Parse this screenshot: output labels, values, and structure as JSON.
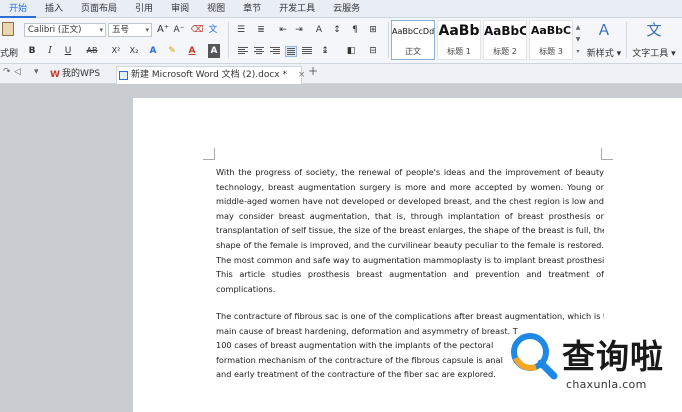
{
  "menu": {
    "tabs": [
      "开始",
      "插入",
      "页面布局",
      "引用",
      "审阅",
      "视图",
      "章节",
      "开发工具",
      "云服务"
    ],
    "active": "开始"
  },
  "ribbon": {
    "paste_label": "式刷",
    "font_name": "Calibri (正文)",
    "font_size": "五号",
    "bold": "B",
    "italic": "I",
    "underline": "U",
    "ab": "AB",
    "superscript": "X²",
    "subscript": "X₂",
    "styles": [
      {
        "preview": "AaBbCcDd",
        "name": "正文"
      },
      {
        "preview": "AaBb",
        "name": "标题 1"
      },
      {
        "preview": "AaBbC",
        "name": "标题 2"
      },
      {
        "preview": "AaBbC",
        "name": "标题 3"
      }
    ],
    "new_style": "新样式",
    "text_tools": "文字工具"
  },
  "tabstrip": {
    "wps_tab": "我的WPS",
    "doc_tab": "新建 Microsoft Word 文档 (2).docx *",
    "close": "×",
    "add": "+"
  },
  "document": {
    "paragraph1": [
      "With the progress of society, the renewal of people's ideas and the improvement of beauty",
      "technology, breast augmentation surgery is more and more accepted by women. Young or",
      "middle-aged women have not developed or developed breast, and the chest region is low and",
      "may consider breast augmentation, that is, through implantation of breast prosthesis or",
      "transplantation of self tissue, the size of the breast enlarges, the shape of the breast is full, the",
      "shape of the female is improved, and the curvilinear beauty peculiar to the female is restored.",
      "The most common and safe way to augmentation mammoplasty is to implant breast prosthesis.",
      "This article studies prosthesis breast augmentation and prevention and treatment of",
      "complications."
    ],
    "paragraph2": [
      "The contracture of fibrous sac is one of the complications after breast augmentation, which is the",
      "main cause of breast hardening, deformation and asymmetry of breast. T",
      "100 cases of breast augmentation with the implants of the pectoral",
      "formation mechanism of the contracture of the fibrous capsule is anal",
      "and early treatment of the contracture of the fiber sac are explored."
    ]
  },
  "watermark": {
    "chinese": "查询啦",
    "url": "chaxunla.com"
  },
  "colors": {
    "accent": "#2a6fd6",
    "watermark_blue": "#1e88e5",
    "watermark_orange": "#f5a623"
  }
}
